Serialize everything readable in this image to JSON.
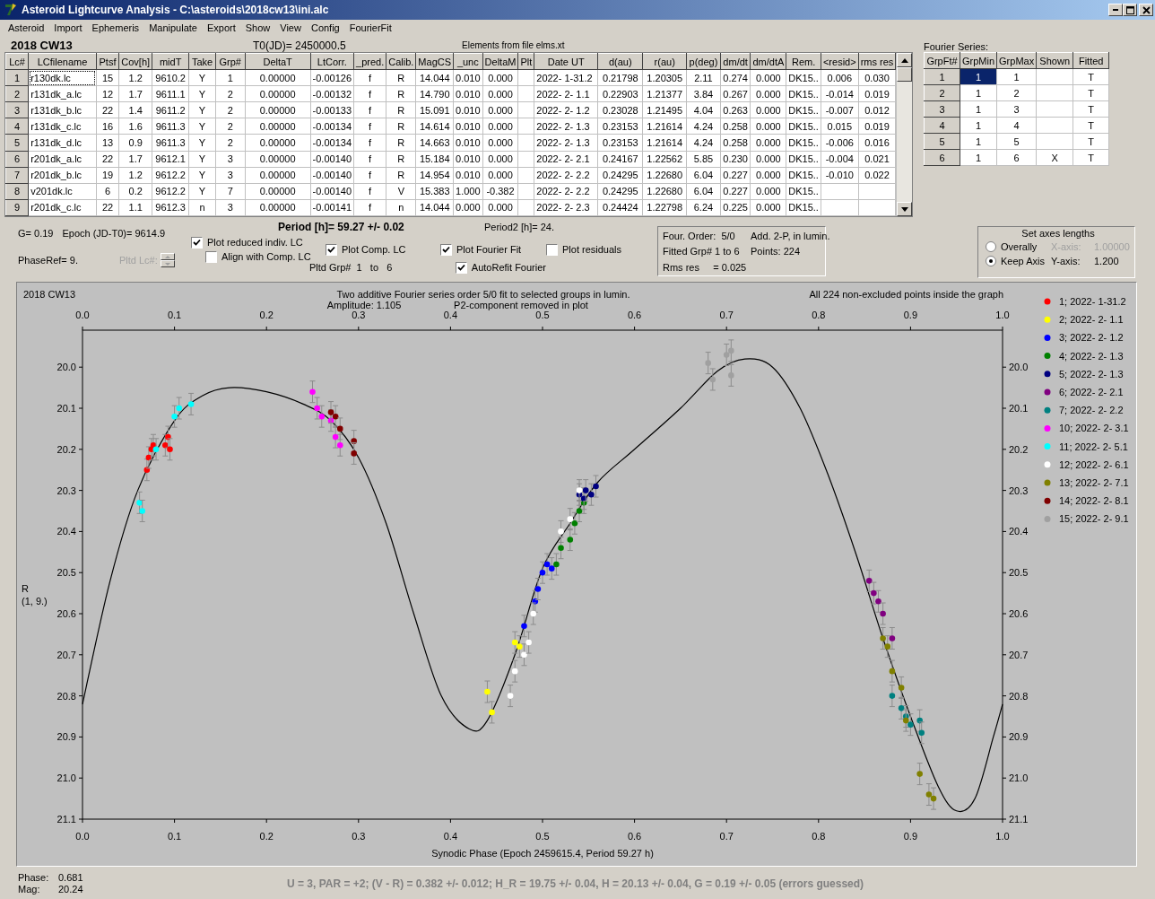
{
  "window": {
    "title": "Asteroid Lightcurve Analysis - C:\\asteroids\\2018cw13\\ini.alc"
  },
  "menu": [
    "Asteroid",
    "Import",
    "Ephemeris",
    "Manipulate",
    "Export",
    "Show",
    "View",
    "Config",
    "FourierFit"
  ],
  "asteroid_name": "2018 CW13",
  "t0": "T0(JD)= 2450000.5",
  "elements_note": "Elements from file elms.xt",
  "lc_table": {
    "columns": [
      "Lc#",
      "LCfilename",
      "Ptsf",
      "Cov[h]",
      "midT",
      "Take",
      "Grp#",
      "DeltaT",
      "LtCorr.",
      "_pred.",
      "Calib.",
      "MagCS",
      "_unc",
      "DeltaM",
      "Plt",
      "Date UT",
      "d(au)",
      "r(au)",
      "p(deg)",
      "dm/dt",
      "dm/dtA",
      "Rem.",
      "<resid>",
      "rms res"
    ],
    "rows": [
      [
        "1",
        "r130dk.lc",
        "15",
        "1.2",
        "9610.2",
        "Y",
        "1",
        "0.00000",
        "-0.00126",
        "f",
        "R",
        "14.044",
        "0.010",
        "0.000",
        null,
        "2022- 1-31.2",
        "0.21798",
        "1.20305",
        "2.11",
        "0.274",
        "0.000",
        "DK15..",
        "0.006",
        "0.030"
      ],
      [
        "2",
        "r131dk_a.lc",
        "12",
        "1.7",
        "9611.1",
        "Y",
        "2",
        "0.00000",
        "-0.00132",
        "f",
        "R",
        "14.790",
        "0.010",
        "0.000",
        null,
        "2022- 2- 1.1",
        "0.22903",
        "1.21377",
        "3.84",
        "0.267",
        "0.000",
        "DK15..",
        "-0.014",
        "0.019"
      ],
      [
        "3",
        "r131dk_b.lc",
        "22",
        "1.4",
        "9611.2",
        "Y",
        "2",
        "0.00000",
        "-0.00133",
        "f",
        "R",
        "15.091",
        "0.010",
        "0.000",
        null,
        "2022- 2- 1.2",
        "0.23028",
        "1.21495",
        "4.04",
        "0.263",
        "0.000",
        "DK15..",
        "-0.007",
        "0.012"
      ],
      [
        "4",
        "r131dk_c.lc",
        "16",
        "1.6",
        "9611.3",
        "Y",
        "2",
        "0.00000",
        "-0.00134",
        "f",
        "R",
        "14.614",
        "0.010",
        "0.000",
        null,
        "2022- 2- 1.3",
        "0.23153",
        "1.21614",
        "4.24",
        "0.258",
        "0.000",
        "DK15..",
        "0.015",
        "0.019"
      ],
      [
        "5",
        "r131dk_d.lc",
        "13",
        "0.9",
        "9611.3",
        "Y",
        "2",
        "0.00000",
        "-0.00134",
        "f",
        "R",
        "14.663",
        "0.010",
        "0.000",
        null,
        "2022- 2- 1.3",
        "0.23153",
        "1.21614",
        "4.24",
        "0.258",
        "0.000",
        "DK15..",
        "-0.006",
        "0.016"
      ],
      [
        "6",
        "r201dk_a.lc",
        "22",
        "1.7",
        "9612.1",
        "Y",
        "3",
        "0.00000",
        "-0.00140",
        "f",
        "R",
        "15.184",
        "0.010",
        "0.000",
        null,
        "2022- 2- 2.1",
        "0.24167",
        "1.22562",
        "5.85",
        "0.230",
        "0.000",
        "DK15..",
        "-0.004",
        "0.021"
      ],
      [
        "7",
        "r201dk_b.lc",
        "19",
        "1.2",
        "9612.2",
        "Y",
        "3",
        "0.00000",
        "-0.00140",
        "f",
        "R",
        "14.954",
        "0.010",
        "0.000",
        null,
        "2022- 2- 2.2",
        "0.24295",
        "1.22680",
        "6.04",
        "0.227",
        "0.000",
        "DK15..",
        "-0.010",
        "0.022"
      ],
      [
        "8",
        "v201dk.lc",
        "6",
        "0.2",
        "9612.2",
        "Y",
        "7",
        "0.00000",
        "-0.00140",
        "f",
        "V",
        "15.383",
        "1.000",
        "-0.382",
        null,
        "2022- 2- 2.2",
        "0.24295",
        "1.22680",
        "6.04",
        "0.227",
        "0.000",
        "DK15..",
        null,
        null
      ],
      [
        "9",
        "r201dk_c.lc",
        "22",
        "1.1",
        "9612.3",
        "n",
        "3",
        "0.00000",
        "-0.00141",
        "f",
        "n",
        "14.044",
        "0.000",
        "0.000",
        null,
        "2022- 2- 2.3",
        "0.24424",
        "1.22798",
        "6.24",
        "0.225",
        "0.000",
        "DK15..",
        null,
        null
      ]
    ]
  },
  "fourier_series": {
    "title": "Fourier Series:",
    "columns": [
      "GrpFt#",
      "GrpMin",
      "GrpMax",
      "Shown",
      "Fitted"
    ],
    "rows": [
      {
        "cells": [
          "1",
          "1",
          "1",
          null,
          "T"
        ],
        "selected": true
      },
      {
        "cells": [
          "2",
          "1",
          "2",
          null,
          "T"
        ],
        "selected": false
      },
      {
        "cells": [
          "3",
          "1",
          "3",
          null,
          "T"
        ],
        "selected": false
      },
      {
        "cells": [
          "4",
          "1",
          "4",
          null,
          "T"
        ],
        "selected": false
      },
      {
        "cells": [
          "5",
          "1",
          "5",
          null,
          "T"
        ],
        "selected": false
      },
      {
        "cells": [
          "6",
          "1",
          "6",
          "X",
          "T"
        ],
        "selected": false
      }
    ]
  },
  "info": {
    "g": "G= 0.19",
    "epoch": "Epoch (JD-T0)= 9614.9",
    "phase_ref": "PhaseRef= 9.",
    "pltd_lc": {
      "label": "Pltd Lc#:",
      "disabled": true
    },
    "period": "Period [h]= 59.27 +/- 0.02",
    "period2": "Period2 [h]= 24.",
    "pltd_grp": "Pltd Grp#  1   to   6",
    "options": [
      {
        "label": "Plot reduced indiv. LC",
        "checked": true
      },
      {
        "label": "Align with Comp. LC",
        "checked": false
      },
      {
        "label": "Plot Comp. LC",
        "checked": true
      },
      {
        "label": "Plot Fourier Fit",
        "checked": true
      },
      {
        "label": "Plot residuals",
        "checked": false
      },
      {
        "label": "AutoRefit Fourier",
        "checked": true
      }
    ]
  },
  "fit_summary": [
    "Four. Order:  5/0",
    "Add. 2-P, in lumin.",
    "Fitted Grp# 1 to 6",
    "Points: 224",
    "Rms res     = 0.025"
  ],
  "axes": {
    "title": "Set axes lengths",
    "options": [
      {
        "label": "Overally",
        "selected": false
      },
      {
        "label": "Keep Axis",
        "selected": true
      }
    ],
    "x_axis": {
      "label": "X-axis:",
      "value": "1.00000",
      "disabled": true
    },
    "y_axis": {
      "label": "Y-axis:",
      "value": "1.200",
      "disabled": false
    }
  },
  "plot": {
    "object_label": "2018 CW13",
    "subtitle": [
      "Amplitude: 1.105",
      "P2-component removed in plot"
    ],
    "note": "All 224 non-excluded points inside the graph",
    "ylabel_lines": [
      "R",
      "(1, 9.)"
    ],
    "chart_data": {
      "type": "scatter",
      "title": "Two additive Fourier series order 5/0 fit to selected groups in lumin.",
      "xlabel": "Synodic Phase (Epoch 2459615.4, Period 59.27 h)",
      "xlim": [
        0,
        1
      ],
      "ylim": [
        21.1,
        19.91
      ],
      "legend": "right",
      "xticks": [
        {
          "value": 0,
          "label": "0.0"
        },
        {
          "value": 0.1,
          "label": "0.1"
        },
        {
          "value": 0.2,
          "label": "0.2"
        },
        {
          "value": 0.3,
          "label": "0.3"
        },
        {
          "value": 0.4,
          "label": "0.4"
        },
        {
          "value": 0.5,
          "label": "0.5"
        },
        {
          "value": 0.6,
          "label": "0.6"
        },
        {
          "value": 0.7,
          "label": "0.7"
        },
        {
          "value": 0.8,
          "label": "0.8"
        },
        {
          "value": 0.9,
          "label": "0.9"
        },
        {
          "value": 1,
          "label": "1.0"
        }
      ],
      "yticks": [
        {
          "value": 20,
          "label": "20.0"
        },
        {
          "value": 20.1,
          "label": "20.1"
        },
        {
          "value": 20.2,
          "label": "20.2"
        },
        {
          "value": 20.3,
          "label": "20.3"
        },
        {
          "value": 20.4,
          "label": "20.4"
        },
        {
          "value": 20.5,
          "label": "20.5"
        },
        {
          "value": 20.6,
          "label": "20.6"
        },
        {
          "value": 20.7,
          "label": "20.7"
        },
        {
          "value": 20.8,
          "label": "20.8"
        },
        {
          "value": 20.9,
          "label": "20.9"
        },
        {
          "value": 21,
          "label": "21.0"
        },
        {
          "value": 21.1,
          "label": "21.1"
        }
      ],
      "series": [
        {
          "name": "1; 2022- 1-31.2",
          "color": "#ff0000",
          "x": [
            0.07,
            0.072,
            0.075,
            0.077,
            0.09,
            0.093,
            0.095
          ],
          "values": [
            20.25,
            20.22,
            20.2,
            20.19,
            20.19,
            20.17,
            20.2
          ]
        },
        {
          "name": "2; 2022- 2- 1.1",
          "color": "#ffff00",
          "x": [
            0.44,
            0.445,
            0.47,
            0.475
          ],
          "values": [
            20.79,
            20.84,
            20.67,
            20.68
          ]
        },
        {
          "name": "3; 2022- 2- 1.2",
          "color": "#0000ff",
          "x": [
            0.48,
            0.492,
            0.495,
            0.5,
            0.505,
            0.51
          ],
          "values": [
            20.63,
            20.57,
            20.54,
            20.5,
            20.48,
            20.49
          ]
        },
        {
          "name": "4; 2022- 2- 1.3",
          "color": "#008000",
          "x": [
            0.515,
            0.52,
            0.53,
            0.535,
            0.54,
            0.545
          ],
          "values": [
            20.48,
            20.44,
            20.42,
            20.38,
            20.35,
            20.33
          ]
        },
        {
          "name": "5; 2022- 2- 1.3",
          "color": "#000080",
          "x": [
            0.54,
            0.545,
            0.558,
            0.553,
            0.547
          ],
          "values": [
            20.31,
            20.32,
            20.29,
            20.31,
            20.3
          ]
        },
        {
          "name": "6; 2022- 2- 2.1",
          "color": "#800080",
          "x": [
            0.855,
            0.86,
            0.865,
            0.87,
            0.88
          ],
          "values": [
            20.52,
            20.55,
            20.57,
            20.6,
            20.66
          ]
        },
        {
          "name": "7; 2022- 2- 2.2",
          "color": "#008080",
          "x": [
            0.88,
            0.89,
            0.895,
            0.9,
            0.91,
            0.912
          ],
          "values": [
            20.8,
            20.83,
            20.85,
            20.87,
            20.86,
            20.89
          ]
        },
        {
          "name": "10; 2022- 2- 3.1",
          "color": "#ff00ff",
          "x": [
            0.25,
            0.255,
            0.26,
            0.27,
            0.275,
            0.28
          ],
          "values": [
            20.06,
            20.1,
            20.12,
            20.13,
            20.17,
            20.19
          ]
        },
        {
          "name": "11; 2022- 2- 5.1",
          "color": "#00ffff",
          "x": [
            0.062,
            0.065,
            0.08,
            0.1,
            0.105,
            0.118
          ],
          "values": [
            20.33,
            20.35,
            20.2,
            20.12,
            20.1,
            20.09
          ]
        },
        {
          "name": "12; 2022- 2- 6.1",
          "color": "#ffffff",
          "x": [
            0.465,
            0.47,
            0.48,
            0.485,
            0.49,
            0.52,
            0.53,
            0.54
          ],
          "values": [
            20.8,
            20.74,
            20.7,
            20.67,
            20.6,
            20.4,
            20.37,
            20.3
          ]
        },
        {
          "name": "13; 2022- 2- 7.1",
          "color": "#808000",
          "x": [
            0.87,
            0.875,
            0.88,
            0.89,
            0.895,
            0.91,
            0.92,
            0.925
          ],
          "values": [
            20.66,
            20.68,
            20.74,
            20.78,
            20.86,
            20.99,
            21.04,
            21.05
          ]
        },
        {
          "name": "14; 2022- 2- 8.1",
          "color": "#800000",
          "x": [
            0.27,
            0.275,
            0.28,
            0.295,
            0.295
          ],
          "values": [
            20.11,
            20.12,
            20.15,
            20.18,
            20.21
          ]
        },
        {
          "name": "15; 2022- 2- 9.1",
          "color": "#a0a0a0",
          "x": [
            0.68,
            0.685,
            0.7,
            0.705,
            0.705
          ],
          "values": [
            19.99,
            20.03,
            19.97,
            19.96,
            20.02
          ]
        },
        {
          "type": "line",
          "color": "#000000",
          "x": [
            0,
            0.03,
            0.06,
            0.1,
            0.13,
            0.16,
            0.2,
            0.24,
            0.27,
            0.3,
            0.33,
            0.36,
            0.39,
            0.42,
            0.44,
            0.47,
            0.5,
            0.53,
            0.56,
            0.6,
            0.65,
            0.69,
            0.72,
            0.75,
            0.78,
            0.81,
            0.84,
            0.87,
            0.9,
            0.93,
            0.95,
            0.97,
            0.99,
            1
          ],
          "values": [
            20.82,
            20.52,
            20.3,
            20.13,
            20.07,
            20.05,
            20.06,
            20.09,
            20.13,
            20.22,
            20.38,
            20.6,
            20.8,
            20.88,
            20.86,
            20.7,
            20.49,
            20.38,
            20.28,
            20.2,
            20.1,
            20.01,
            19.98,
            20.0,
            20.1,
            20.26,
            20.45,
            20.66,
            20.85,
            21.02,
            21.08,
            21.05,
            20.9,
            20.82
          ]
        }
      ]
    }
  },
  "bottom": {
    "phase": {
      "label": "Phase:",
      "value": "0.681"
    },
    "mag": {
      "label": "Mag:",
      "value": "20.24"
    },
    "results": "U = 3, PAR = +2; (V - R) = 0.382 +/- 0.012; H_R = 19.75 +/- 0.04, H = 20.13 +/- 0.04, G = 0.19 +/- 0.05 (errors guessed)"
  }
}
